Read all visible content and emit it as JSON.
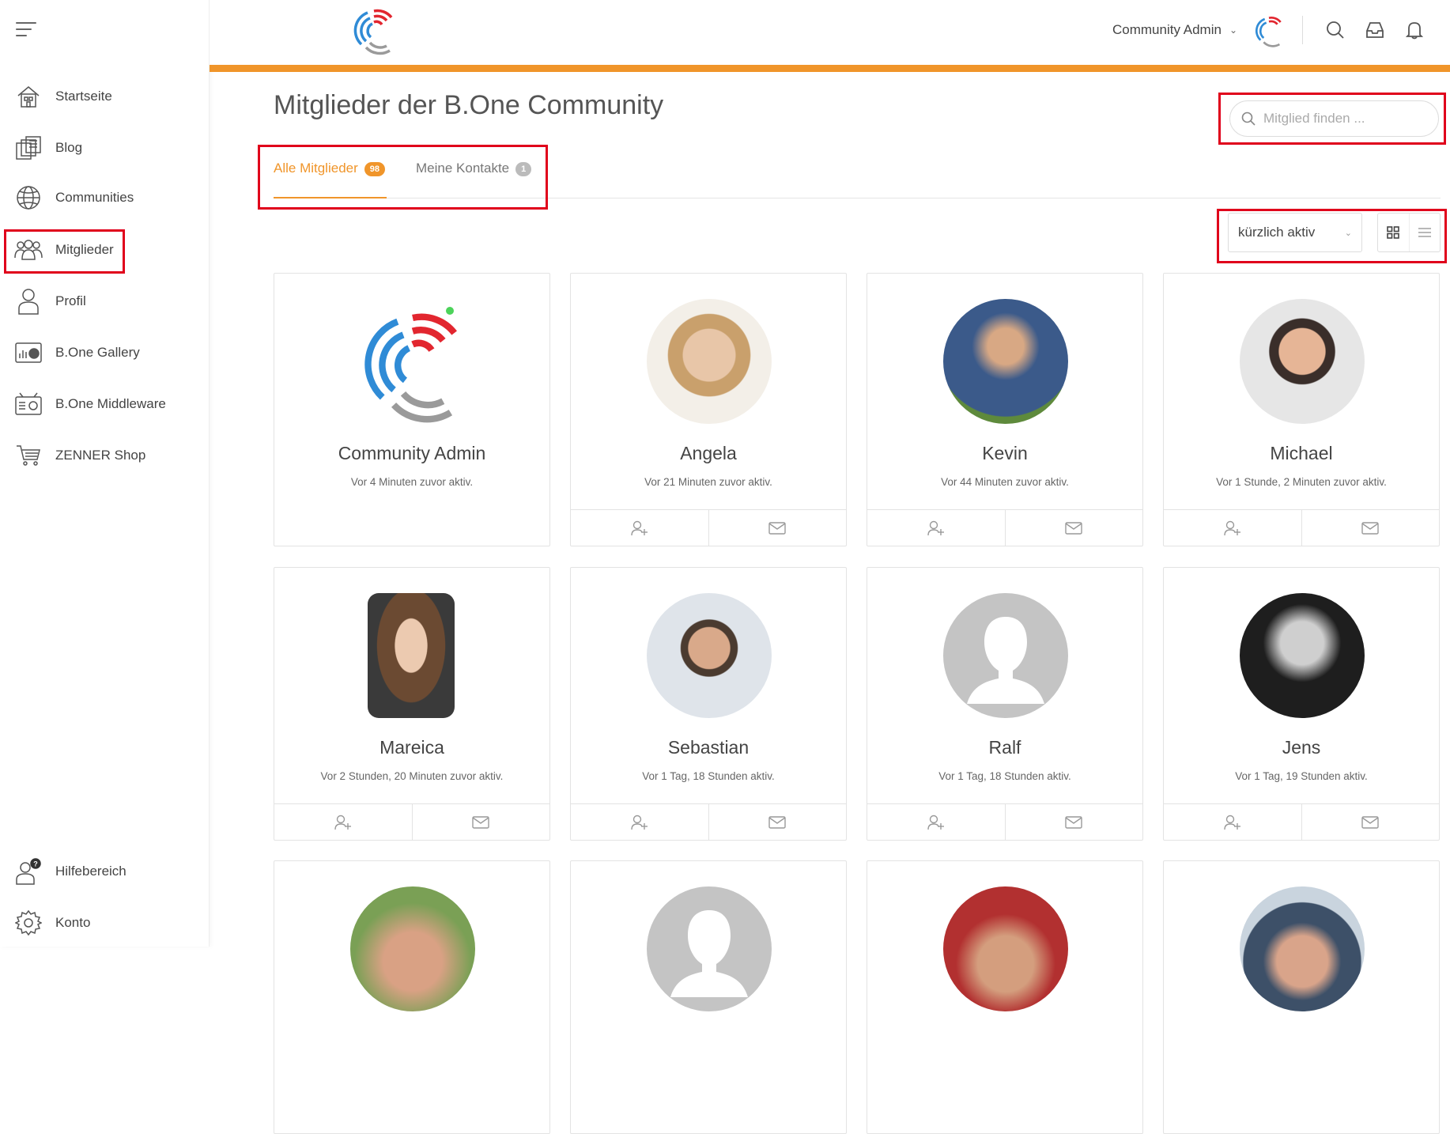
{
  "header": {
    "user_name": "Community Admin"
  },
  "sidebar": {
    "items": [
      {
        "label": "Startseite",
        "icon": "home-icon"
      },
      {
        "label": "Blog",
        "icon": "blog-icon"
      },
      {
        "label": "Communities",
        "icon": "globe-icon"
      },
      {
        "label": "Mitglieder",
        "icon": "members-icon"
      },
      {
        "label": "Profil",
        "icon": "profile-icon"
      },
      {
        "label": "B.One Gallery",
        "icon": "gallery-icon"
      },
      {
        "label": "B.One Middleware",
        "icon": "middleware-icon"
      },
      {
        "label": "ZENNER Shop",
        "icon": "cart-icon"
      }
    ],
    "bottom_items": [
      {
        "label": "Hilfebereich",
        "icon": "help-icon"
      },
      {
        "label": "Konto",
        "icon": "gear-icon"
      }
    ]
  },
  "main": {
    "title": "Mitglieder der B.One Community",
    "search_placeholder": "Mitglied finden ...",
    "tabs": [
      {
        "label": "Alle Mitglieder",
        "count": "98",
        "active": true,
        "badge_color": "#f0952a"
      },
      {
        "label": "Meine Kontakte",
        "count": "1",
        "active": false,
        "badge_color": "#bbbbbb"
      }
    ],
    "sort": {
      "selected": "kürzlich aktiv"
    },
    "members": [
      {
        "name": "Community Admin",
        "status": "Vor 4 Minuten zuvor aktiv."
      },
      {
        "name": "Angela",
        "status": "Vor 21 Minuten zuvor aktiv."
      },
      {
        "name": "Kevin",
        "status": "Vor 44 Minuten zuvor aktiv."
      },
      {
        "name": "Michael",
        "status": "Vor 1 Stunde, 2 Minuten zuvor aktiv."
      },
      {
        "name": "Mareica",
        "status": "Vor 2 Stunden, 20 Minuten zuvor aktiv."
      },
      {
        "name": "Sebastian",
        "status": "Vor 1 Tag, 18 Stunden aktiv."
      },
      {
        "name": "Ralf",
        "status": "Vor 1 Tag, 18 Stunden aktiv."
      },
      {
        "name": "Jens",
        "status": "Vor 1 Tag, 19 Stunden aktiv."
      }
    ]
  },
  "colors": {
    "accent": "#f0952a",
    "highlight": "#e0001b",
    "logo_red": "#e2262f",
    "logo_blue": "#2f8bd6",
    "logo_gray": "#9a9a9a"
  }
}
